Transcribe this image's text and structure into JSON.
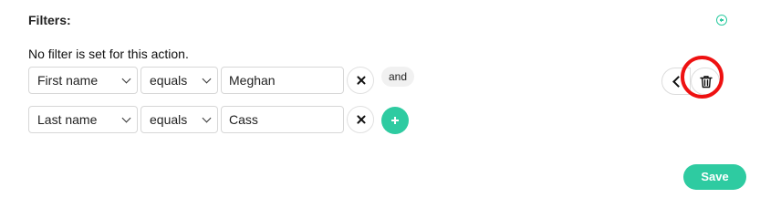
{
  "filters": {
    "title": "Filters:",
    "empty_notice": "No filter is set for this action.",
    "rows": [
      {
        "field": "First name",
        "operator": "equals",
        "value": "Meghan",
        "connector": "and"
      },
      {
        "field": "Last name",
        "operator": "equals",
        "value": "Cass"
      }
    ]
  },
  "actions": {
    "save_label": "Save"
  },
  "icons": {
    "add_filter": "plus-circle-icon",
    "remove": "close-icon",
    "add_row": "plus-icon",
    "previous": "chevron-left-icon",
    "delete": "trash-icon"
  },
  "colors": {
    "accent": "#2ecba1",
    "highlight": "#ee1111"
  }
}
